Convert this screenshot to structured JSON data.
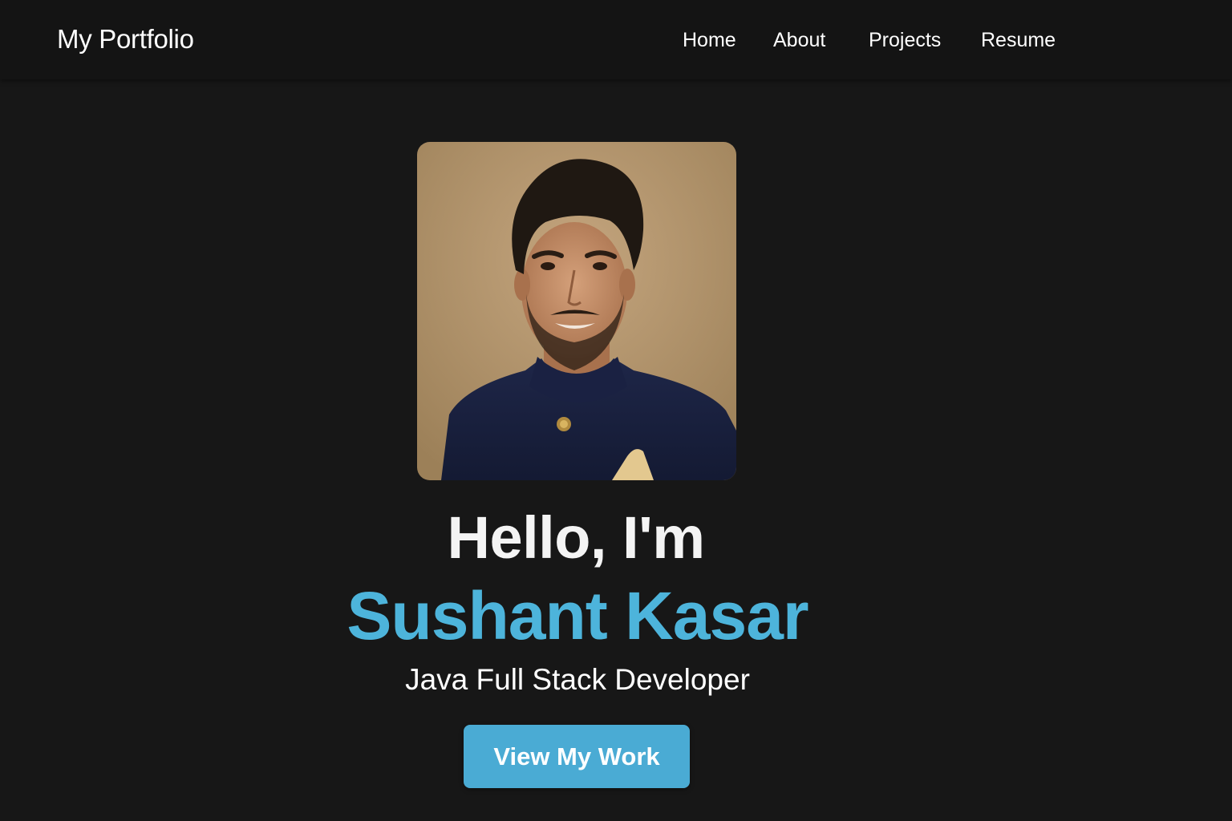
{
  "navbar": {
    "brand": "My Portfolio",
    "links": [
      {
        "label": "Home"
      },
      {
        "label": "About"
      },
      {
        "label": "Projects"
      },
      {
        "label": "Resume"
      }
    ]
  },
  "hero": {
    "greeting": "Hello, I'm",
    "name": "Sushant Kasar",
    "role": "Java Full Stack Developer",
    "cta_label": "View My Work",
    "photo_alt": "profile-photo"
  },
  "colors": {
    "background": "#171717",
    "navbar": "#141414",
    "accent": "#4db4db",
    "button": "#4aabd4"
  }
}
